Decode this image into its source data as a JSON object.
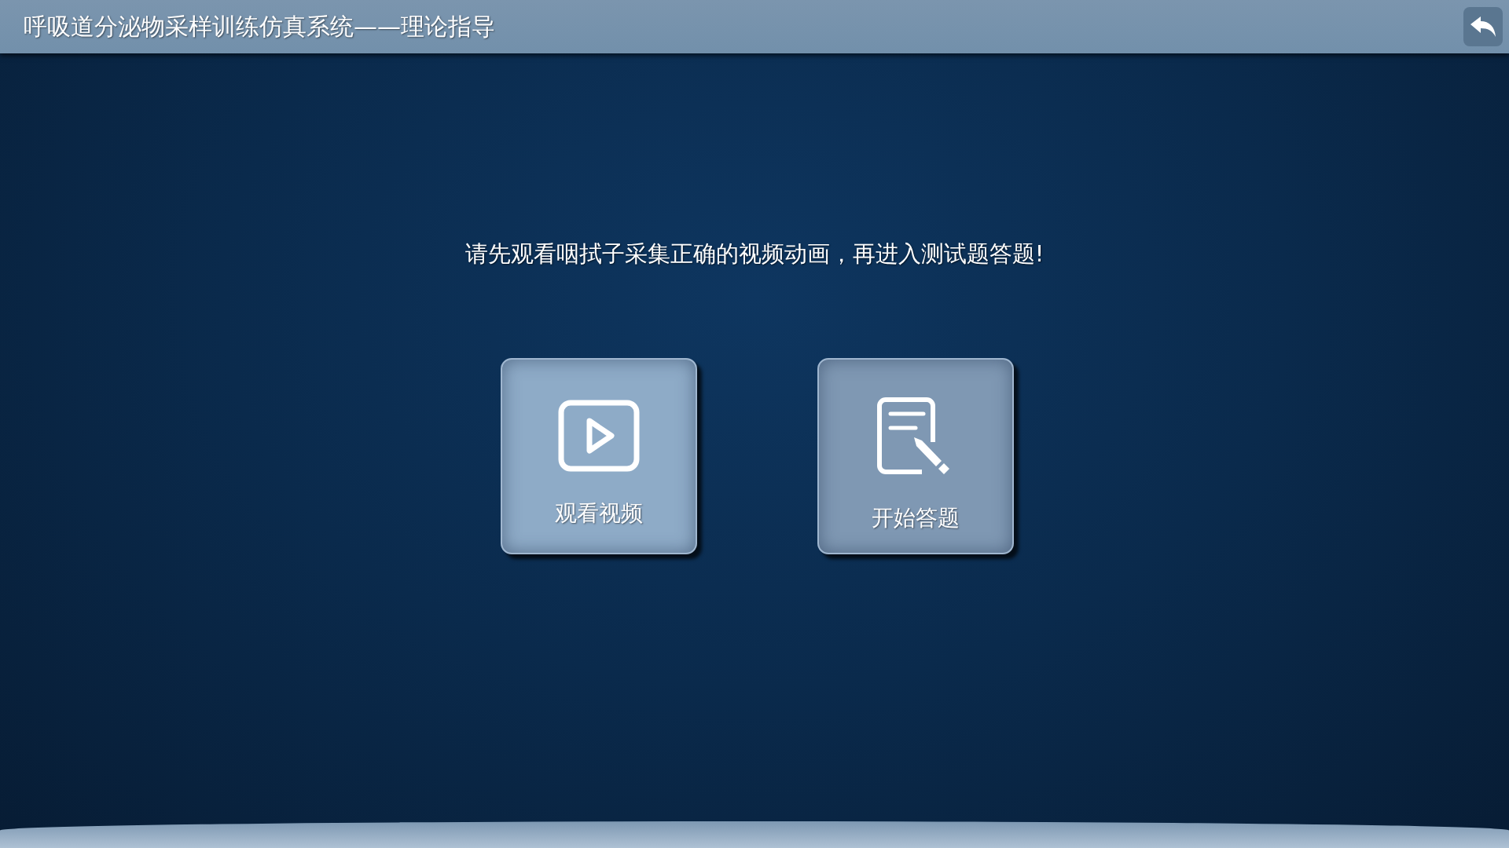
{
  "header": {
    "title": "呼吸道分泌物采样训练仿真系统——理论指导"
  },
  "instruction": "请先观看咽拭子采集正确的视频动画，再进入测试题答题!",
  "actions": [
    {
      "kind": "video",
      "label": "观看视频",
      "selected": true
    },
    {
      "kind": "quiz",
      "label": "开始答题",
      "selected": false
    }
  ]
}
